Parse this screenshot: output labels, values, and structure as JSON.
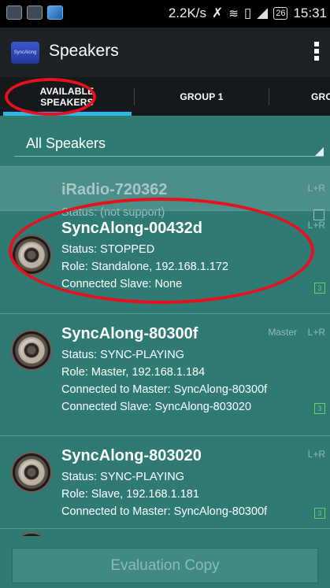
{
  "status_bar": {
    "speed": "2.2K/s",
    "battery": "26",
    "time": "15:31"
  },
  "app": {
    "icon_text": "SyncAlong",
    "title": "Speakers"
  },
  "tabs": [
    {
      "line1": "AVAILABLE",
      "line2": "SPEAKERS",
      "selected": true
    },
    {
      "label": "GROUP 1",
      "selected": false
    },
    {
      "label": "GRO",
      "selected": false
    }
  ],
  "filter": {
    "selected": "All Speakers"
  },
  "speakers": [
    {
      "name": "iRadio-720362",
      "lines": [
        "Status: (not support)"
      ],
      "channel": "L+R",
      "enabled": false
    },
    {
      "name": "SyncAlong-00432d",
      "lines": [
        "Status: STOPPED",
        "Role: Standalone,  192.168.1.172",
        "Connected Slave: None"
      ],
      "channel": "L+R",
      "badge": "3",
      "enabled": true
    },
    {
      "name": "SyncAlong-80300f",
      "lines": [
        "Status: SYNC-PLAYING",
        "Role: Master,  192.168.1.184",
        "Connected to Master: SyncAlong-80300f",
        "Connected Slave: SyncAlong-803020"
      ],
      "role_tag": "Master",
      "channel": "L+R",
      "badge": "3",
      "enabled": true
    },
    {
      "name": "SyncAlong-803020",
      "lines": [
        "Status: SYNC-PLAYING",
        "Role: Slave,  192.168.1.181",
        "Connected to Master: SyncAlong-80300f"
      ],
      "channel": "L+R",
      "badge": "3",
      "enabled": true
    }
  ],
  "footer": {
    "button_label": "Evaluation Copy"
  },
  "colors": {
    "background": "#2f7b74",
    "accent": "#33b5e5",
    "annotation": "#e8101c",
    "badge": "#67d26a"
  }
}
